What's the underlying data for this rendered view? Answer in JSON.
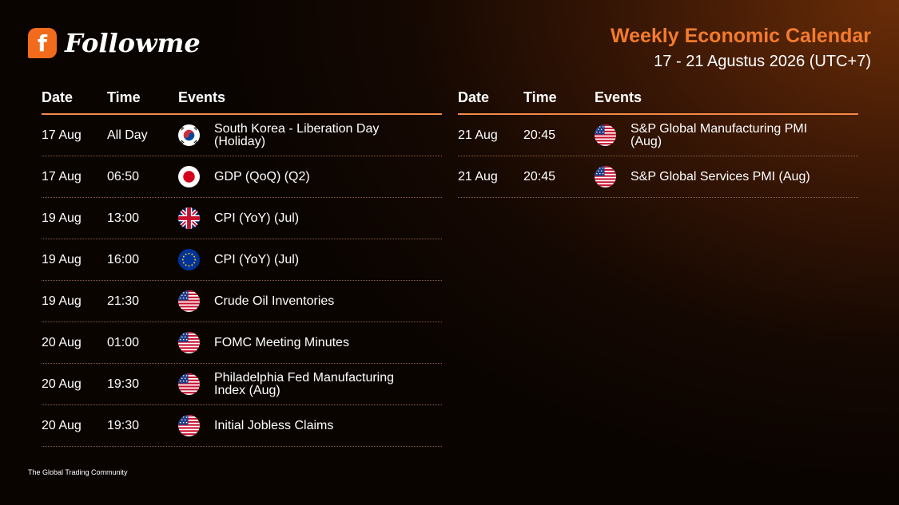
{
  "brand": {
    "logo_letter": "f",
    "name": "Followme",
    "tagline": "The Global Trading Community"
  },
  "header": {
    "title": "Weekly Economic Calendar",
    "range": "17 - 21 Agustus 2026 (UTC+7)"
  },
  "columns": {
    "date": "Date",
    "time": "Time",
    "events": "Events"
  },
  "colors": {
    "accent": "#f37b2c",
    "rule": "#f58a4a"
  },
  "left_events": [
    {
      "date": "17 Aug",
      "time": "All Day",
      "flag": "south-korea-flag",
      "event": "South Korea - Liberation Day (Holiday)"
    },
    {
      "date": "17 Aug",
      "time": "06:50",
      "flag": "japan-flag",
      "event": "GDP (QoQ) (Q2)"
    },
    {
      "date": "19 Aug",
      "time": "13:00",
      "flag": "uk-flag",
      "event": "CPI (YoY) (Jul)"
    },
    {
      "date": "19 Aug",
      "time": "16:00",
      "flag": "eu-flag",
      "event": "CPI (YoY) (Jul)"
    },
    {
      "date": "19 Aug",
      "time": "21:30",
      "flag": "us-flag",
      "event": "Crude Oil Inventories"
    },
    {
      "date": "20 Aug",
      "time": "01:00",
      "flag": "us-flag",
      "event": "FOMC Meeting Minutes"
    },
    {
      "date": "20 Aug",
      "time": "19:30",
      "flag": "us-flag",
      "event": "Philadelphia Fed Manufacturing Index (Aug)"
    },
    {
      "date": "20 Aug",
      "time": "19:30",
      "flag": "us-flag",
      "event": "Initial Jobless Claims"
    }
  ],
  "right_events": [
    {
      "date": "21 Aug",
      "time": "20:45",
      "flag": "us-flag",
      "event": "S&P Global Manufacturing PMI (Aug)"
    },
    {
      "date": "21 Aug",
      "time": "20:45",
      "flag": "us-flag",
      "event": "S&P Global Services PMI (Aug)"
    }
  ]
}
